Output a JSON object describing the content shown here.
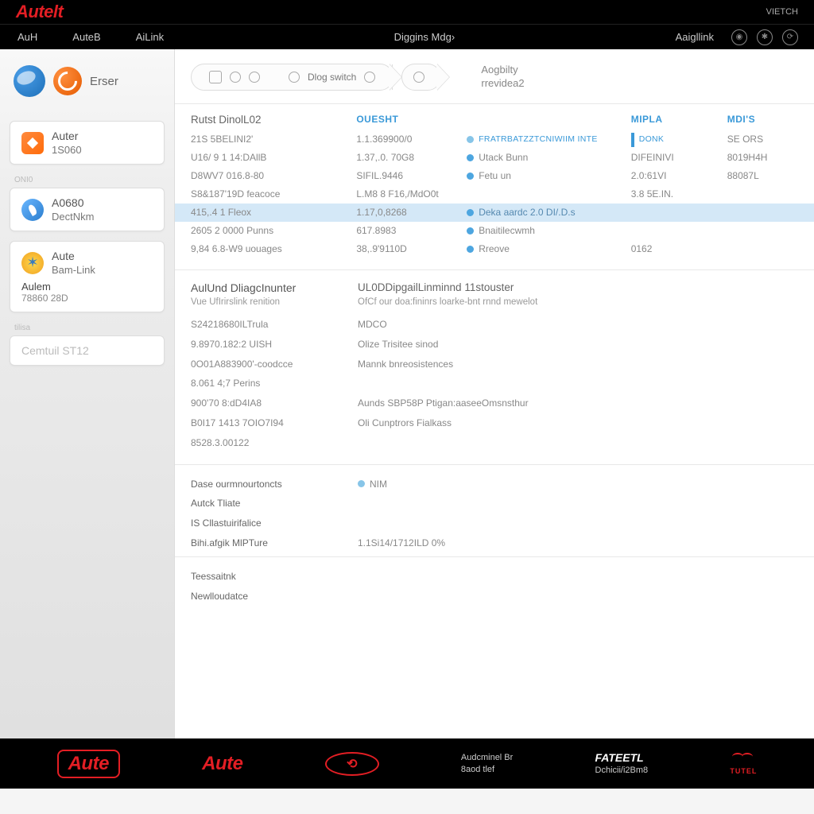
{
  "brand": {
    "logo": "Autelt",
    "top_right": "VIETCH"
  },
  "menu": {
    "items": [
      "AuH",
      "AuteB",
      "AiLink"
    ],
    "center": "Diggins Mdg›",
    "right": "Aaigllink"
  },
  "sidebar": {
    "eraser": "Erser",
    "cards": [
      {
        "title": "Auter",
        "sub": "1S060"
      },
      {
        "title": "A0680",
        "sub": "DectNkm"
      },
      {
        "title": "Aute",
        "sub": "Bam-Link",
        "line1": "Aulem",
        "line2": "78860 28D"
      },
      {
        "title": "Cemtuil ST12"
      }
    ]
  },
  "breadcrumb": {
    "step2": "Dlog switch",
    "side_t": "Aogbilty",
    "side_b": "rrevidea2"
  },
  "sec1": {
    "h1": "Rutst DinolL02",
    "h2": "OUESHT",
    "h4": "MIPLA",
    "h5": "MDI'S",
    "rows": [
      {
        "c1": "21S 5BELINI2'",
        "c2": "1.1.369900/0",
        "c3": "FRATRBATZZTCNIWIIM INTE",
        "c4_badge": "DONK",
        "c5": "SE ORS"
      },
      {
        "c1": "U16/ 9 1 14:DAllB",
        "c2": "1.37,.0. 70G8",
        "c3": "Utack Bunn",
        "c4": "DIFEINIVI",
        "c5": "8019H4H"
      },
      {
        "c1": "D8WV7 016.8-80",
        "c2": "SIFIL.9446",
        "c3": "Fetu un",
        "c4": "2.0:61VI",
        "c5": "88087L"
      },
      {
        "c1": "S8&187'19D feacoce",
        "c2": "L.M8 8 F16,/MdO0t",
        "c3": "",
        "c4": "3.8 5E.IN.",
        "c5": ""
      },
      {
        "c1": "415,.4 1 Fleox",
        "c2": "1.17,0,8268",
        "c3": "Deka aardc 2.0 DI/.D.s",
        "c4": "",
        "c5": ""
      },
      {
        "c1": "2605 2 0000 Punns",
        "c2": "617.8983",
        "c3": "Bnaitilecwmh",
        "c4": "",
        "c5": ""
      },
      {
        "c1": "9,84 6.8-W9 uouages",
        "c2": "38,.9'9110D",
        "c3": "Rreove",
        "c4": "0162",
        "c5": ""
      }
    ]
  },
  "sec2": {
    "h1": "AulUnd DliagcInunter",
    "h2": "UL0DDipgailLinminnd 11stouster",
    "s1": "Vue UfIrirslink renition",
    "s2": "OfCf our doa:fininrs loarke-bnt rnnd mewelot",
    "rows": [
      {
        "c1": "S24218680ILTrula",
        "c2": "MDCO"
      },
      {
        "c1": "9.8970.182:2 UISH",
        "c2": "Olize Trisitee sinod"
      },
      {
        "c1": "0O01A883900'-coodcce",
        "c2": "Mannk bnreosistences"
      },
      {
        "c1": "8.061 4;7 Perins",
        "c2": ""
      },
      {
        "c1": "900'70 8:dD4IA8",
        "c2": "Aunds SBP58P Ptigan:aaseeOmsnsthur"
      },
      {
        "c1": "B0I17 1413 7OIO7I94",
        "c2": "Oli Cunptrors Fialkass"
      },
      {
        "c1": "8528.3.00122",
        "c2": ""
      }
    ]
  },
  "sec3": {
    "rows": [
      {
        "c1": "Dase ourmnourtoncts",
        "c2_dot": true,
        "c2": "NIM"
      },
      {
        "c1": "Autck Tliate",
        "c2": ""
      },
      {
        "c1": "IS Cllastuirifalice",
        "c2": ""
      },
      {
        "c1": "Bihi.afgik MlPTure",
        "c2": "1.1Si14/1712ILD 0%"
      }
    ]
  },
  "sec4": {
    "rows": [
      {
        "c1": "Teessaitnk"
      },
      {
        "c1": "Newlloudatce"
      }
    ]
  },
  "footer": {
    "l1": "Aute",
    "l2": "Aute",
    "oval": "⟲",
    "stack1_t": "Audcminel Br",
    "stack1_b": "8aod tlef",
    "stack2_t": "FATEETL",
    "stack2_b": "Dchicii/i2Bm8",
    "mark": "TUTEL"
  }
}
